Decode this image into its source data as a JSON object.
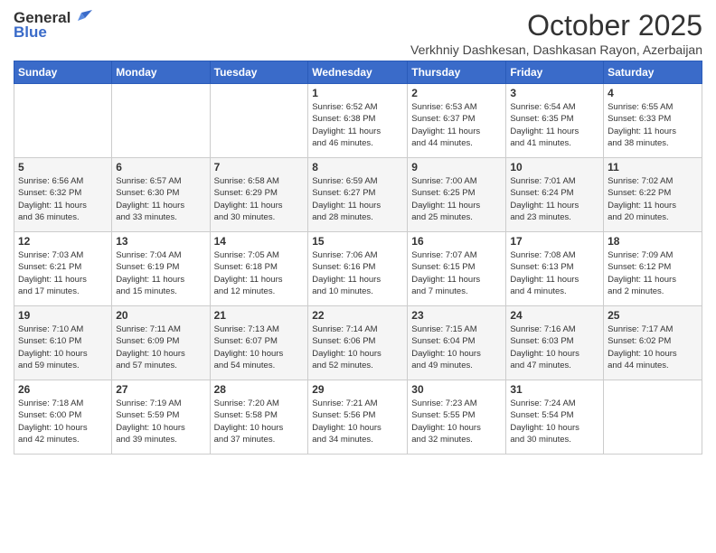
{
  "header": {
    "logo_general": "General",
    "logo_blue": "Blue",
    "title": "October 2025",
    "subtitle": "Verkhniy Dashkesan, Dashkasan Rayon, Azerbaijan"
  },
  "weekdays": [
    "Sunday",
    "Monday",
    "Tuesday",
    "Wednesday",
    "Thursday",
    "Friday",
    "Saturday"
  ],
  "weeks": [
    [
      {
        "day": "",
        "info": ""
      },
      {
        "day": "",
        "info": ""
      },
      {
        "day": "",
        "info": ""
      },
      {
        "day": "1",
        "info": "Sunrise: 6:52 AM\nSunset: 6:38 PM\nDaylight: 11 hours\nand 46 minutes."
      },
      {
        "day": "2",
        "info": "Sunrise: 6:53 AM\nSunset: 6:37 PM\nDaylight: 11 hours\nand 44 minutes."
      },
      {
        "day": "3",
        "info": "Sunrise: 6:54 AM\nSunset: 6:35 PM\nDaylight: 11 hours\nand 41 minutes."
      },
      {
        "day": "4",
        "info": "Sunrise: 6:55 AM\nSunset: 6:33 PM\nDaylight: 11 hours\nand 38 minutes."
      }
    ],
    [
      {
        "day": "5",
        "info": "Sunrise: 6:56 AM\nSunset: 6:32 PM\nDaylight: 11 hours\nand 36 minutes."
      },
      {
        "day": "6",
        "info": "Sunrise: 6:57 AM\nSunset: 6:30 PM\nDaylight: 11 hours\nand 33 minutes."
      },
      {
        "day": "7",
        "info": "Sunrise: 6:58 AM\nSunset: 6:29 PM\nDaylight: 11 hours\nand 30 minutes."
      },
      {
        "day": "8",
        "info": "Sunrise: 6:59 AM\nSunset: 6:27 PM\nDaylight: 11 hours\nand 28 minutes."
      },
      {
        "day": "9",
        "info": "Sunrise: 7:00 AM\nSunset: 6:25 PM\nDaylight: 11 hours\nand 25 minutes."
      },
      {
        "day": "10",
        "info": "Sunrise: 7:01 AM\nSunset: 6:24 PM\nDaylight: 11 hours\nand 23 minutes."
      },
      {
        "day": "11",
        "info": "Sunrise: 7:02 AM\nSunset: 6:22 PM\nDaylight: 11 hours\nand 20 minutes."
      }
    ],
    [
      {
        "day": "12",
        "info": "Sunrise: 7:03 AM\nSunset: 6:21 PM\nDaylight: 11 hours\nand 17 minutes."
      },
      {
        "day": "13",
        "info": "Sunrise: 7:04 AM\nSunset: 6:19 PM\nDaylight: 11 hours\nand 15 minutes."
      },
      {
        "day": "14",
        "info": "Sunrise: 7:05 AM\nSunset: 6:18 PM\nDaylight: 11 hours\nand 12 minutes."
      },
      {
        "day": "15",
        "info": "Sunrise: 7:06 AM\nSunset: 6:16 PM\nDaylight: 11 hours\nand 10 minutes."
      },
      {
        "day": "16",
        "info": "Sunrise: 7:07 AM\nSunset: 6:15 PM\nDaylight: 11 hours\nand 7 minutes."
      },
      {
        "day": "17",
        "info": "Sunrise: 7:08 AM\nSunset: 6:13 PM\nDaylight: 11 hours\nand 4 minutes."
      },
      {
        "day": "18",
        "info": "Sunrise: 7:09 AM\nSunset: 6:12 PM\nDaylight: 11 hours\nand 2 minutes."
      }
    ],
    [
      {
        "day": "19",
        "info": "Sunrise: 7:10 AM\nSunset: 6:10 PM\nDaylight: 10 hours\nand 59 minutes."
      },
      {
        "day": "20",
        "info": "Sunrise: 7:11 AM\nSunset: 6:09 PM\nDaylight: 10 hours\nand 57 minutes."
      },
      {
        "day": "21",
        "info": "Sunrise: 7:13 AM\nSunset: 6:07 PM\nDaylight: 10 hours\nand 54 minutes."
      },
      {
        "day": "22",
        "info": "Sunrise: 7:14 AM\nSunset: 6:06 PM\nDaylight: 10 hours\nand 52 minutes."
      },
      {
        "day": "23",
        "info": "Sunrise: 7:15 AM\nSunset: 6:04 PM\nDaylight: 10 hours\nand 49 minutes."
      },
      {
        "day": "24",
        "info": "Sunrise: 7:16 AM\nSunset: 6:03 PM\nDaylight: 10 hours\nand 47 minutes."
      },
      {
        "day": "25",
        "info": "Sunrise: 7:17 AM\nSunset: 6:02 PM\nDaylight: 10 hours\nand 44 minutes."
      }
    ],
    [
      {
        "day": "26",
        "info": "Sunrise: 7:18 AM\nSunset: 6:00 PM\nDaylight: 10 hours\nand 42 minutes."
      },
      {
        "day": "27",
        "info": "Sunrise: 7:19 AM\nSunset: 5:59 PM\nDaylight: 10 hours\nand 39 minutes."
      },
      {
        "day": "28",
        "info": "Sunrise: 7:20 AM\nSunset: 5:58 PM\nDaylight: 10 hours\nand 37 minutes."
      },
      {
        "day": "29",
        "info": "Sunrise: 7:21 AM\nSunset: 5:56 PM\nDaylight: 10 hours\nand 34 minutes."
      },
      {
        "day": "30",
        "info": "Sunrise: 7:23 AM\nSunset: 5:55 PM\nDaylight: 10 hours\nand 32 minutes."
      },
      {
        "day": "31",
        "info": "Sunrise: 7:24 AM\nSunset: 5:54 PM\nDaylight: 10 hours\nand 30 minutes."
      },
      {
        "day": "",
        "info": ""
      }
    ]
  ]
}
